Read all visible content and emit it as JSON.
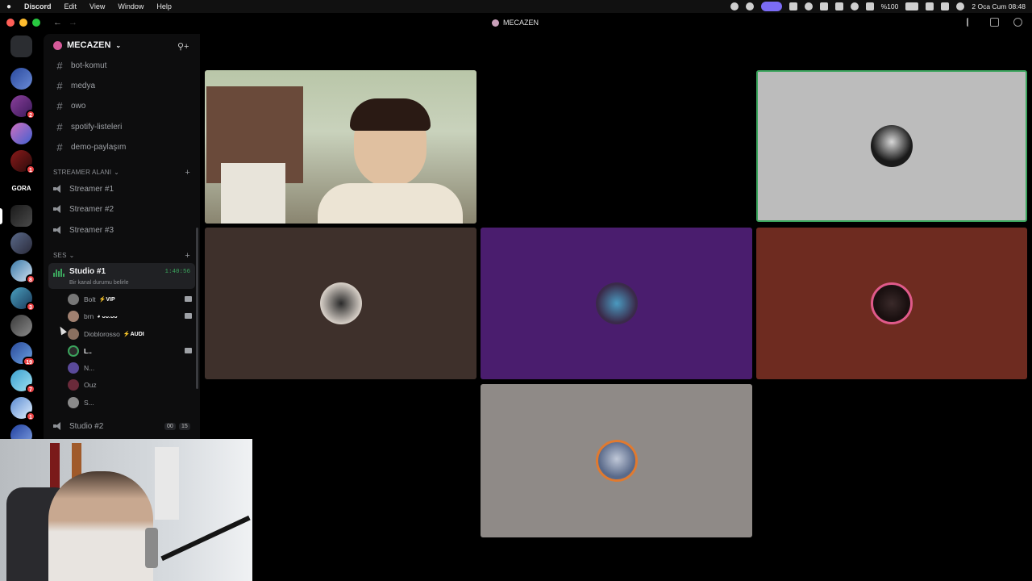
{
  "menubar": {
    "app_menu": "Discord",
    "items": [
      "Edit",
      "View",
      "Window",
      "Help"
    ],
    "battery": "%100",
    "datetime": "2 Oca Cum  08:48"
  },
  "window": {
    "title": "MECAZEN"
  },
  "server_rail": {
    "label_text_server": "GORA",
    "badges": [
      "2",
      "1",
      "8",
      "3",
      "19",
      "7",
      "1",
      "1"
    ]
  },
  "sidebar": {
    "server_name": "MECAZEN",
    "text_channels": [
      "bot-komut",
      "medya",
      "owo",
      "spotify-listeleri",
      "demo-paylaşım"
    ],
    "category_streamer": "STREAMER ALANI",
    "streamer_channels": [
      "Streamer #1",
      "Streamer #2",
      "Streamer #3"
    ],
    "category_voice": "SES",
    "active_voice": {
      "name": "Studio #1",
      "time": "1:40:56",
      "status": "Bir kanal durumu belirle"
    },
    "voice_users": [
      {
        "name": "Bolt",
        "tag": "⚡VIP"
      },
      {
        "name": "brn",
        "tag": "◕ ᴗᴗ.ᴗᴗ"
      },
      {
        "name": "Dioblorosso",
        "tag": "⚡AUDI"
      },
      {
        "name": "L..",
        "tag": ""
      },
      {
        "name": "N...",
        "tag": ""
      },
      {
        "name": "Ouz",
        "tag": ""
      },
      {
        "name": "S...",
        "tag": ""
      }
    ],
    "studio2": {
      "name": "Studio #2",
      "count_a": "00",
      "count_b": "15"
    }
  },
  "colors": {
    "tile_dark_brown": "#3e302b",
    "tile_purple": "#4a1d6e",
    "tile_rust": "#6e2b20",
    "tile_grey": "#8f8a87",
    "tile_light": "#bcbcbc",
    "accent_green": "#3ba55d"
  }
}
